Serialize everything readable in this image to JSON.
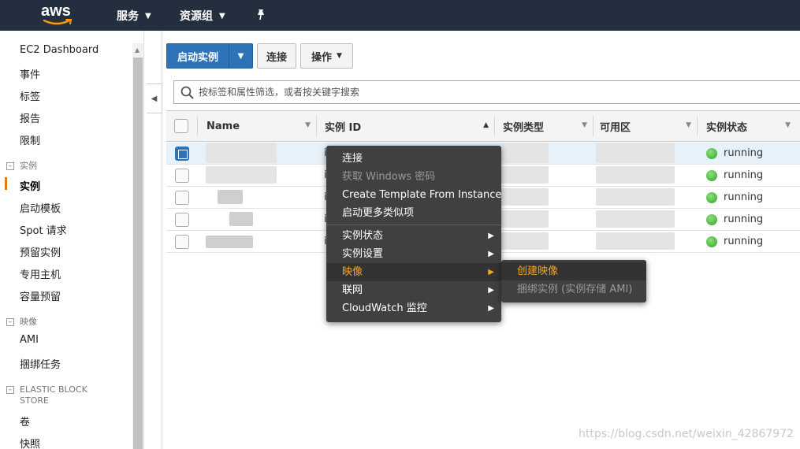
{
  "topnav": {
    "logo": "aws",
    "services_label": "服务",
    "resource_groups_label": "资源组",
    "pin_icon": "pin-icon"
  },
  "sidebar": {
    "items": [
      {
        "label": "EC2 Dashboard"
      },
      {
        "label": "事件"
      },
      {
        "label": "标签"
      },
      {
        "label": "报告"
      },
      {
        "label": "限制"
      }
    ],
    "section_instances": "实例",
    "instances_items": [
      {
        "label": "实例",
        "active": true
      },
      {
        "label": "启动模板"
      },
      {
        "label": "Spot 请求"
      },
      {
        "label": "预留实例"
      },
      {
        "label": "专用主机"
      },
      {
        "label": "容量预留"
      }
    ],
    "section_images": "映像",
    "images_items": [
      {
        "label": "AMI"
      },
      {
        "label": "捆绑任务"
      }
    ],
    "section_ebs": "ELASTIC BLOCK STORE",
    "ebs_items": [
      {
        "label": "卷"
      },
      {
        "label": "快照"
      }
    ]
  },
  "toolbar": {
    "launch_label": "启动实例",
    "connect_label": "连接",
    "actions_label": "操作"
  },
  "search": {
    "placeholder": "按标签和属性筛选，或者按关键字搜索"
  },
  "table": {
    "columns": [
      "Name",
      "实例 ID",
      "实例类型",
      "可用区",
      "实例状态"
    ],
    "rows": [
      {
        "state": "running",
        "id_prefix": "i",
        "selected": true
      },
      {
        "state": "running",
        "id_prefix": "i",
        "selected": false
      },
      {
        "state": "running",
        "id_prefix": "i",
        "selected": false
      },
      {
        "state": "running",
        "id_prefix": "i",
        "selected": false
      },
      {
        "state": "running",
        "id_prefix": "i",
        "selected": false
      }
    ]
  },
  "context_menu": {
    "items": [
      {
        "label": "连接"
      },
      {
        "label": "获取 Windows 密码",
        "disabled": true
      },
      {
        "label": "Create Template From Instance"
      },
      {
        "label": "启动更多类似项"
      },
      {
        "label": "实例状态",
        "submenu": true
      },
      {
        "label": "实例设置",
        "submenu": true
      },
      {
        "label": "映像",
        "submenu": true,
        "hover": true
      },
      {
        "label": "联网",
        "submenu": true
      },
      {
        "label": "CloudWatch 监控",
        "submenu": true
      }
    ],
    "submenu": [
      {
        "label": "创建映像",
        "hover": true
      },
      {
        "label": "捆绑实例 (实例存储 AMI)",
        "disabled": true
      }
    ]
  },
  "watermark": "https://blog.csdn.net/weixin_42867972",
  "colors": {
    "nav_bg": "#232f3e",
    "primary": "#2e73b8",
    "accent": "#e47911",
    "menu_bg": "#404040",
    "menu_hover": "#f5a623",
    "running": "#2fa32a"
  }
}
